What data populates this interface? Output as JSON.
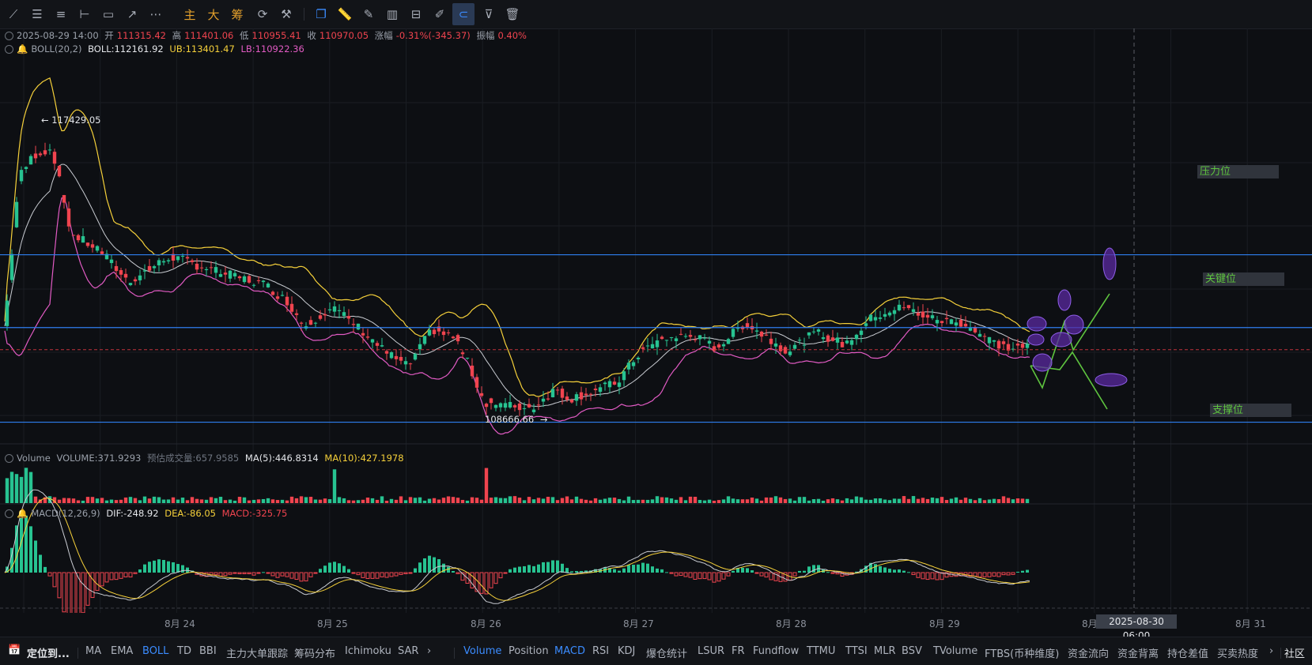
{
  "toolbar": {
    "labels": [
      "主",
      "大",
      "筹"
    ]
  },
  "ohlc": {
    "time": "2025-08-29 14:00",
    "open_label": "开",
    "open": "111315.42",
    "high_label": "高",
    "high": "111401.06",
    "low_label": "低",
    "low": "110955.41",
    "close_label": "收",
    "close": "110970.05",
    "change_label": "涨幅",
    "change": "-0.31%(-345.37)",
    "amp_label": "振幅",
    "amp": "0.40%"
  },
  "boll": {
    "name": "BOLL(20,2)",
    "boll": "BOLL:112161.92",
    "ub": "UB:113401.47",
    "lb": "LB:110922.36"
  },
  "volume_info": {
    "name": "Volume",
    "vol": "VOLUME:371.9293",
    "est": "预估成交量:657.9585",
    "ma5": "MA(5):446.8314",
    "ma10": "MA(10):427.1978"
  },
  "macd_info": {
    "name": "MACD(12,26,9)",
    "dif": "DIF:-248.92",
    "dea": "DEA:-86.05",
    "macd": "MACD:-325.75"
  },
  "levels": {
    "resistance": "压力位",
    "key": "关键位",
    "support": "支撑位"
  },
  "annotations": {
    "high_price": "117429.05",
    "low_price": "108666.66"
  },
  "x_axis": [
    "8月 24",
    "8月 25",
    "8月 26",
    "8月 27",
    "8月 28",
    "8月 29",
    "8月",
    "8月 31"
  ],
  "crosshair_label": "2025-08-30 06:00",
  "bottom": {
    "locate": "定位到...",
    "main_indicators": [
      "MA",
      "EMA",
      "BOLL",
      "TD",
      "BBI",
      "主力大单跟踪",
      "筹码分布",
      "Ichimoku",
      "SAR"
    ],
    "sub_indicators": [
      "Volume",
      "Position",
      "MACD",
      "RSI",
      "KDJ",
      "爆仓统计",
      "LSUR",
      "FR",
      "Fundflow",
      "TTMU",
      "TTSI",
      "MLR",
      "BSV",
      "TVolume",
      "FTBS(币种维度)",
      "资金流向",
      "资金背离",
      "持仓差值",
      "买卖热度"
    ],
    "cut": "社区"
  },
  "colors": {
    "up": "#27c391",
    "down": "#f0444f",
    "ub": "#f5d03a",
    "lb": "#e25bc4",
    "mid": "#c9ccd2",
    "level": "#2f7ff0",
    "accent": "#3b8cff"
  },
  "chart_data": {
    "type": "candlestick",
    "interval": "1h",
    "x_ticks": [
      "8月 24",
      "8月 25",
      "8月 26",
      "8月 27",
      "8月 28",
      "8月 29",
      "8月 31"
    ],
    "price_range": [
      108300,
      121000
    ],
    "horizontal_levels": [
      {
        "name": "压力位",
        "value": 113850
      },
      {
        "name": "关键位",
        "value": 111550
      },
      {
        "name": "支撑位",
        "value": 108560
      }
    ],
    "price_waypoints": [
      [
        0,
        111600
      ],
      [
        6,
        116300
      ],
      [
        12,
        117000
      ],
      [
        20,
        117200
      ],
      [
        28,
        114500
      ],
      [
        40,
        114000
      ],
      [
        52,
        113000
      ],
      [
        70,
        113800
      ],
      [
        90,
        113300
      ],
      [
        110,
        112900
      ],
      [
        120,
        112300
      ],
      [
        126,
        111600
      ],
      [
        138,
        112200
      ],
      [
        150,
        111500
      ],
      [
        160,
        110800
      ],
      [
        170,
        110300
      ],
      [
        180,
        111500
      ],
      [
        190,
        111200
      ],
      [
        196,
        110300
      ],
      [
        202,
        109200
      ],
      [
        210,
        109100
      ],
      [
        222,
        109000
      ],
      [
        232,
        109600
      ],
      [
        238,
        109300
      ],
      [
        246,
        109500
      ],
      [
        258,
        109800
      ],
      [
        268,
        110800
      ],
      [
        278,
        111200
      ],
      [
        290,
        111300
      ],
      [
        300,
        110900
      ],
      [
        312,
        111700
      ],
      [
        330,
        110800
      ],
      [
        342,
        111400
      ],
      [
        354,
        111000
      ],
      [
        366,
        111900
      ],
      [
        378,
        112200
      ],
      [
        392,
        111800
      ],
      [
        404,
        111700
      ],
      [
        414,
        111200
      ],
      [
        422,
        110900
      ],
      [
        432,
        110950
      ]
    ],
    "macd_range": [
      -950,
      950
    ]
  }
}
